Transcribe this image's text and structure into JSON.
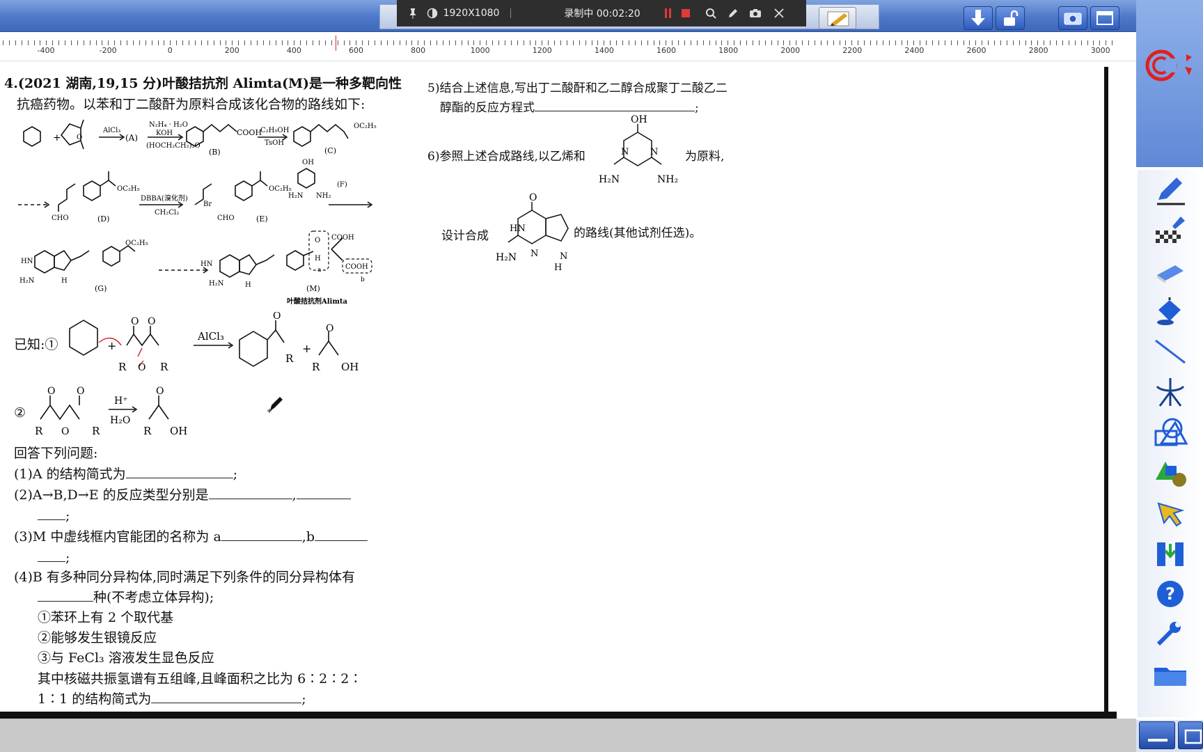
{
  "recorder": {
    "resolution": "1920X1080",
    "status": "录制中 00:02:20"
  },
  "ruler": {
    "labels": [
      "-400",
      "-200",
      "0",
      "200",
      "400",
      "600",
      "800",
      "1000",
      "1200",
      "1400",
      "1600",
      "1800",
      "2000",
      "2200",
      "2400",
      "2600",
      "2800",
      "3000"
    ]
  },
  "question": {
    "header": "4.(2021 湖南,19,15 分)叶酸拮抗剂 Alimta(M)是一种多靶向性",
    "header2": "抗癌药物。以苯和丁二酸酐为原料合成该化合物的路线如下:",
    "known_label": "已知:①",
    "known2_label": "②",
    "answer_intro": "回答下列问题:",
    "q1": "(1)A 的结构简式为",
    "q2": "(2)A→B,D→E 的反应类型分别是",
    "q3": "(3)M 中虚线框内官能团的名称为 a",
    "q3b": ",b",
    "q4": "(4)B 有多种同分异构体,同时满足下列条件的同分异构体有",
    "q4b": "种(不考虑立体异构);",
    "c1": "①苯环上有 2 个取代基",
    "c2": "②能够发生银镜反应",
    "c3": "③与 FeCl₃ 溶液发生显色反应",
    "q4c": "其中核磁共振氢谱有五组峰,且峰面积之比为 6∶2∶2∶",
    "q4d": "1∶1 的结构简式为",
    "q5": "5)结合上述信息,写出丁二酸酐和乙二醇合成聚丁二酸乙二",
    "q5b": "醇酯的反应方程式",
    "q6": "6)参照上述合成路线,以乙烯和",
    "q6b": "为原料,",
    "q6c": "设计合成",
    "q6d": "的路线(其他试剂任选)。"
  },
  "chem": {
    "alcl3": "AlCl₃",
    "a": "(A)",
    "n2h4": "N₂H₄ · H₂O",
    "koh": "KOH",
    "glycol": "(HOCH₂CH₂)₂O",
    "b": "(B)",
    "cooh": "COOH",
    "etoh": "C₂H₅OH",
    "tsoh": "TsOH",
    "c": "(C)",
    "oc2h5": "OC₂H₅",
    "d": "(D)",
    "cho": "CHO",
    "dbba": "DBBA(溴化剂)",
    "ch2cl2": "CH₂Cl₂",
    "br": "Br",
    "e": "(E)",
    "f": "(F)",
    "oh": "OH",
    "h2n": "H₂N",
    "nh2": "NH₂",
    "g": "(G)",
    "m": "(M)",
    "alimta": "叶酸拮抗剂Alimta",
    "hn": "HN",
    "h": "H",
    "n": "N",
    "o": "O",
    "r": "R",
    "plus": "+",
    "hplus": "H⁺",
    "h2o": "H₂O",
    "box_a": "a",
    "box_b": "b"
  }
}
